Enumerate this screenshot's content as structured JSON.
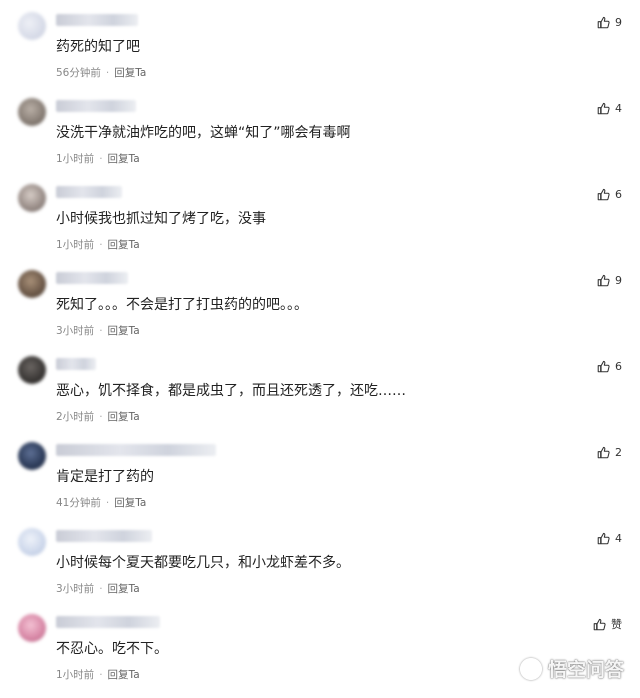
{
  "comments": [
    {
      "text": "药死的知了吧",
      "time": "56分钟前",
      "reply": "回复Ta",
      "likes": "9",
      "avatar_color": "#d7dbe8"
    },
    {
      "text": "没洗干净就油炸吃的吧，这蝉“知了”哪会有毒啊",
      "time": "1小时前",
      "reply": "回复Ta",
      "likes": "4",
      "avatar_color": "#8a8078"
    },
    {
      "text": "小时候我也抓过知了烤了吃，没事",
      "time": "1小时前",
      "reply": "回复Ta",
      "likes": "6",
      "avatar_color": "#9b8f8a"
    },
    {
      "text": "死知了。。。不会是打了打虫药的的吧。。。",
      "time": "3小时前",
      "reply": "回复Ta",
      "likes": "9",
      "avatar_color": "#6e5a4a"
    },
    {
      "text": "恶心，饥不择食，都是成虫了，而且还死透了，还吃……",
      "time": "2小时前",
      "reply": "回复Ta",
      "likes": "6",
      "avatar_color": "#3d3a38"
    },
    {
      "text": "肯定是打了药的",
      "time": "41分钟前",
      "reply": "回复Ta",
      "likes": "2",
      "avatar_color": "#2f3e5c"
    },
    {
      "text": "小时候每个夏天都要吃几只，和小龙虾差不多。",
      "time": "3小时前",
      "reply": "回复Ta",
      "likes": "4",
      "avatar_color": "#cfd9ec"
    },
    {
      "text": "不忍心。吃不下。",
      "time": "1小时前",
      "reply": "回复Ta",
      "likes": "赞",
      "avatar_color": "#d98aa8"
    }
  ],
  "watermark": "悟空问答"
}
